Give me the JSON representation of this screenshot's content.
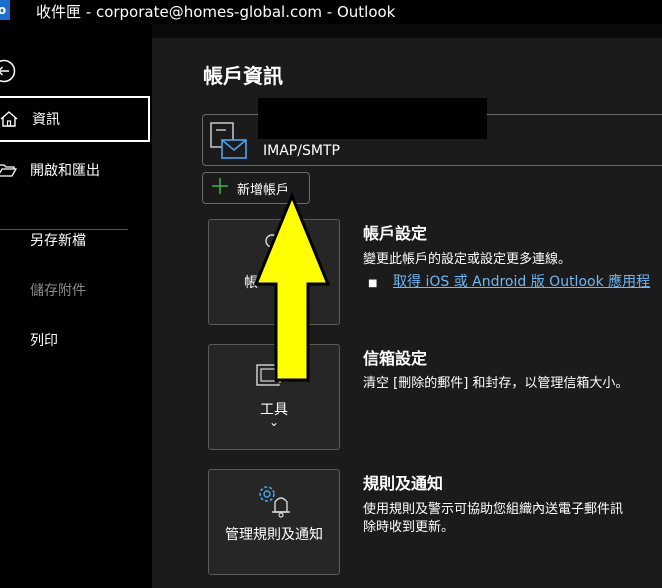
{
  "window": {
    "title": "收件匣 - corporate@homes-global.com  -  Outlook"
  },
  "app_icon": {
    "letter": "o"
  },
  "nav": {
    "items": [
      {
        "label": "資訊",
        "icon": "home-icon",
        "active": true
      },
      {
        "label": "開啟和匯出",
        "icon": "folder-open-icon"
      },
      {
        "label": "另存新檔"
      },
      {
        "label": "儲存附件",
        "disabled": true
      },
      {
        "label": "列印"
      }
    ]
  },
  "page": {
    "title": "帳戶資訊"
  },
  "account": {
    "type": "IMAP/SMTP",
    "add_label": "新增帳戶"
  },
  "sections": [
    {
      "title": "帳戶設定",
      "description": "變更此帳戶的設定或設定更多連線。",
      "bullet": "■",
      "link": "取得 iOS 或 Android 版 Outlook 應用程",
      "tile_label": "帳"
    },
    {
      "title": "信箱設定",
      "description": "清空 [刪除的郵件] 和封存，以管理信箱大小。",
      "tile_label": "工具",
      "tile_chevron": "⌄"
    },
    {
      "title": "規則及通知",
      "description_lines": [
        "使用規則及警示可協助您組織內送電子郵件訊",
        "除時收到更新。"
      ],
      "tile_label": "管理規則及通知"
    }
  ],
  "colors": {
    "accent_link": "#6fb6f4",
    "add_plus": "#3ea84a",
    "mail_icon": "#4aa3f0",
    "annotation_arrow": "#ffff00"
  }
}
